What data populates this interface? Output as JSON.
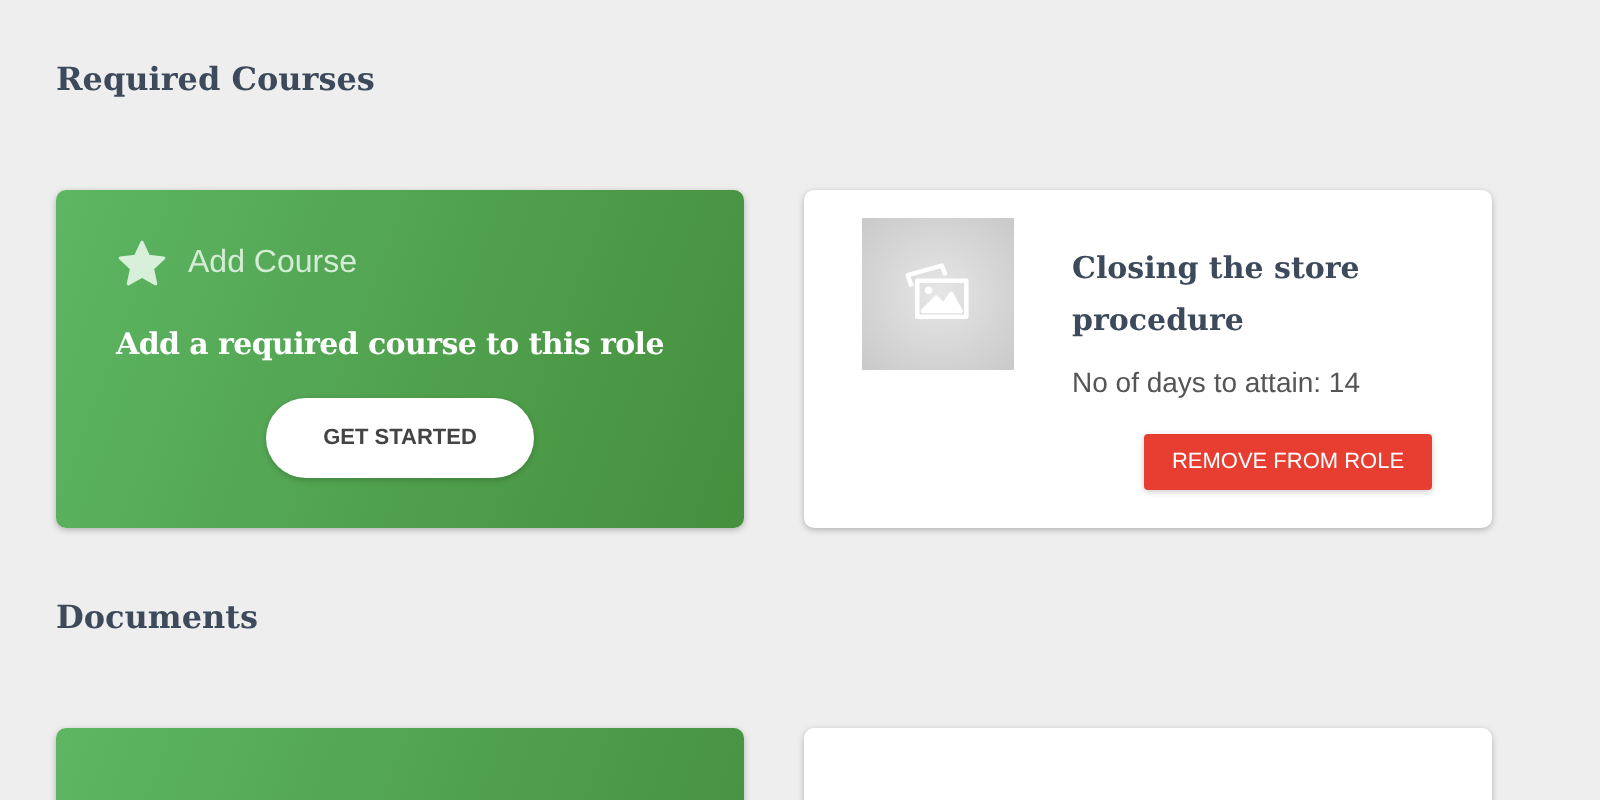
{
  "sections": [
    {
      "title": "Required Courses",
      "cards": [
        {
          "kind": "add",
          "label": "Add Course",
          "heading": "Add a required course to this role",
          "button": "GET STARTED"
        },
        {
          "kind": "course",
          "title": "Closing the store procedure",
          "meta": "No of days to attain: 14",
          "button": "REMOVE FROM ROLE"
        }
      ]
    },
    {
      "title": "Documents",
      "cards": [
        {
          "kind": "add"
        },
        {
          "kind": "course"
        }
      ]
    }
  ]
}
